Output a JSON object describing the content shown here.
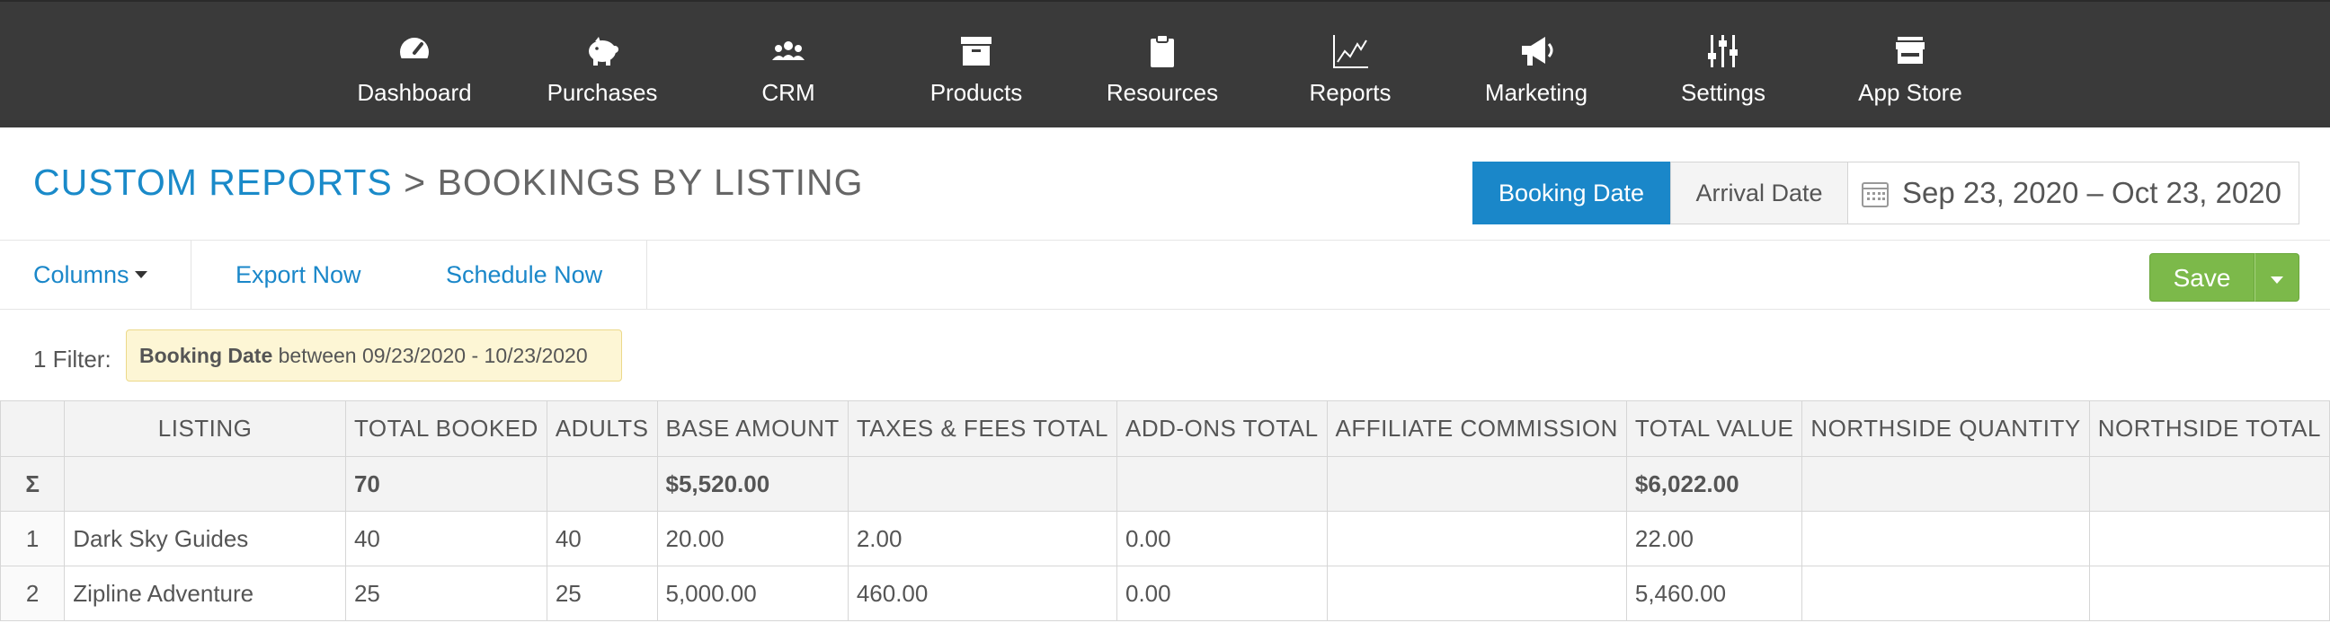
{
  "nav": {
    "items": [
      {
        "label": "Dashboard",
        "icon": "dashboard-gauge-icon"
      },
      {
        "label": "Purchases",
        "icon": "piggy-bank-icon"
      },
      {
        "label": "CRM",
        "icon": "users-group-icon"
      },
      {
        "label": "Products",
        "icon": "archive-box-icon"
      },
      {
        "label": "Resources",
        "icon": "clipboard-icon"
      },
      {
        "label": "Reports",
        "icon": "line-chart-icon"
      },
      {
        "label": "Marketing",
        "icon": "megaphone-icon"
      },
      {
        "label": "Settings",
        "icon": "sliders-icon"
      },
      {
        "label": "App Store",
        "icon": "storefront-icon"
      }
    ]
  },
  "breadcrumb": {
    "parent": "CUSTOM REPORTS",
    "separator": ">",
    "current": "BOOKINGS BY LISTING"
  },
  "date_toggle": {
    "booking": "Booking Date",
    "arrival": "Arrival Date",
    "selected": "Booking Date"
  },
  "date_range": "Sep 23, 2020 – Oct 23, 2020",
  "toolbar": {
    "columns": "Columns",
    "export": "Export Now",
    "schedule": "Schedule Now",
    "save": "Save"
  },
  "filter": {
    "label": "1 Filter:",
    "field": "Booking Date",
    "condition": "between 09/23/2020 - 10/23/2020"
  },
  "table": {
    "sum_symbol": "Σ",
    "columns": [
      "LISTING",
      "TOTAL BOOKED",
      "ADULTS",
      "BASE AMOUNT",
      "TAXES & FEES TOTAL",
      "ADD-ONS TOTAL",
      "AFFILIATE COMMISSION",
      "TOTAL VALUE",
      "NORTHSIDE QUANTITY",
      "NORTHSIDE TOTAL"
    ],
    "totals": [
      "",
      "70",
      "",
      "$5,520.00",
      "",
      "",
      "",
      "$6,022.00",
      "",
      ""
    ],
    "rows": [
      {
        "index": "1",
        "cells": [
          "Dark Sky Guides",
          "40",
          "40",
          "20.00",
          "2.00",
          "0.00",
          "",
          "22.00",
          "",
          ""
        ]
      },
      {
        "index": "2",
        "cells": [
          "Zipline Adventure",
          "25",
          "25",
          "5,000.00",
          "460.00",
          "0.00",
          "",
          "5,460.00",
          "",
          ""
        ]
      }
    ]
  },
  "colors": {
    "nav_bg": "#3a3a3a",
    "link": "#1a87c9",
    "primary": "#1a87c9",
    "save_green": "#7cb94a",
    "filter_chip_bg": "#fdf6d5"
  }
}
